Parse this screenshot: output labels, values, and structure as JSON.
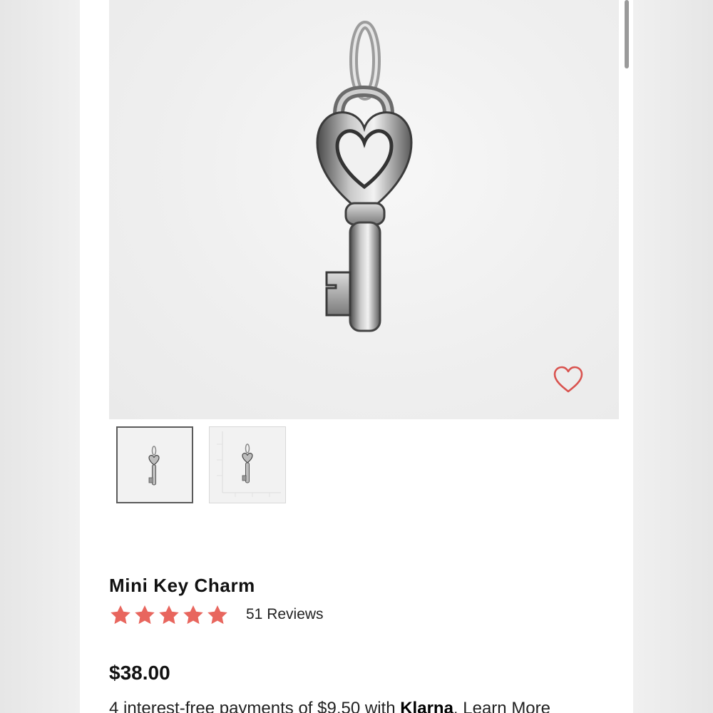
{
  "product": {
    "title": "Mini Key Charm",
    "rating": 5,
    "rating_max": 5,
    "reviews_label": "51 Reviews",
    "price": "$38.00"
  },
  "financing": {
    "prefix": "4 interest-free payments of $9.50 with ",
    "brand": "Klarna",
    "learn_more": "Learn More"
  },
  "gallery": {
    "thumbnails": [
      "product-photo",
      "size-chart-photo"
    ],
    "selected": 0
  },
  "colors": {
    "accent": "#e8665e",
    "favorite_outline": "#d9534f"
  },
  "icons": {
    "favorite": "heart-outline-icon",
    "rating": "star-icon"
  }
}
